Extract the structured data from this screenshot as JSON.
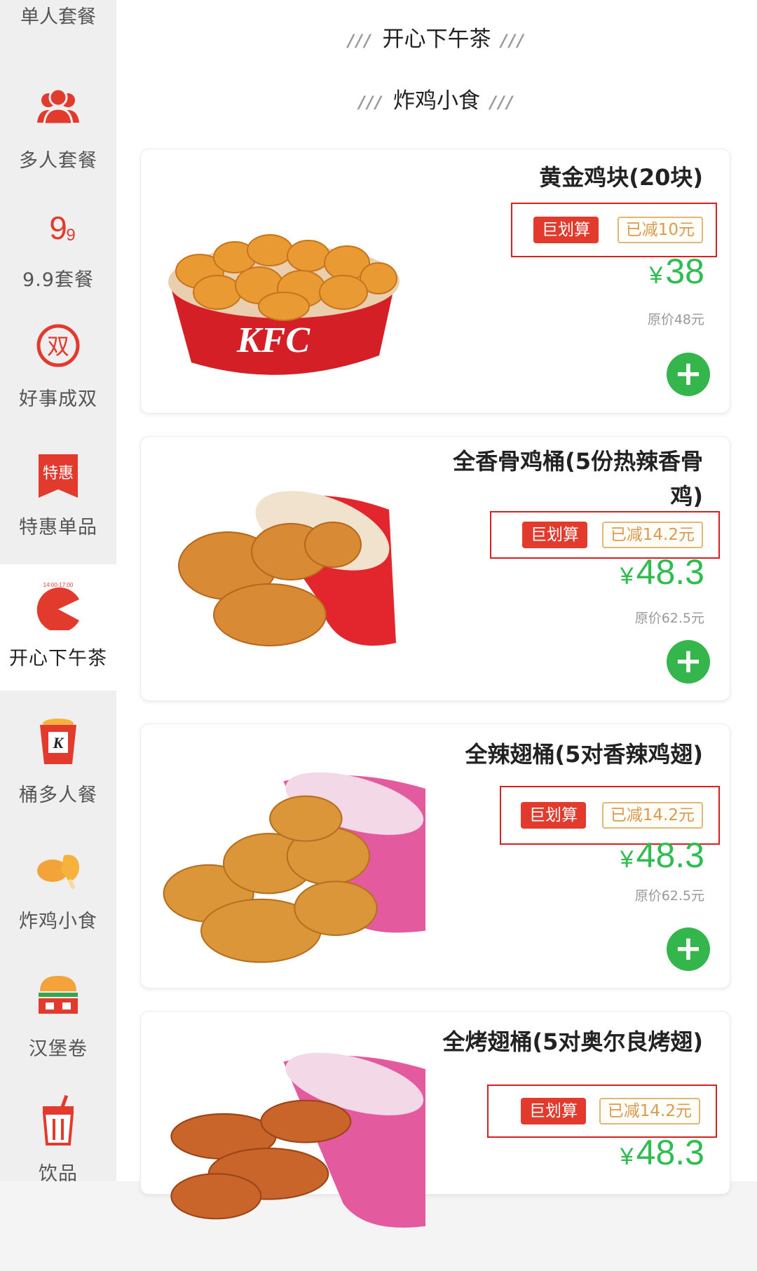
{
  "sidebar": {
    "top_cut_label": "单人套餐",
    "items": [
      {
        "label": "多人套餐",
        "icon": "group-icon"
      },
      {
        "label": "9.9套餐",
        "icon": "nine-nine-icon",
        "icon_text": "9.9"
      },
      {
        "label": "好事成双",
        "icon": "double-happiness-icon",
        "icon_text": "双"
      },
      {
        "label": "特惠单品",
        "icon": "special-offer-icon",
        "icon_text": "特惠"
      },
      {
        "label": "开心下午茶",
        "icon": "afternoon-tea-clock-icon",
        "icon_text": "14:00-17:00",
        "active": true
      },
      {
        "label": "桶多人餐",
        "icon": "bucket-icon",
        "icon_text": "K"
      },
      {
        "label": "炸鸡小食",
        "icon": "fried-chicken-icon"
      },
      {
        "label": "汉堡卷",
        "icon": "burger-icon"
      },
      {
        "label": "饮品",
        "icon": "drink-cup-icon"
      }
    ]
  },
  "main": {
    "section_title": "开心下午茶",
    "category_title": "炸鸡小食",
    "slashes": "///",
    "products": [
      {
        "name": "黄金鸡块(20块)",
        "badge": "巨划算",
        "discount": "已减10元",
        "currency": "¥",
        "price": "38",
        "original": "原价48元",
        "add_label": "+",
        "image": "nuggets-bucket",
        "bucket_text": "KFC"
      },
      {
        "name": "全香骨鸡桶(5份热辣香骨鸡)",
        "badge": "巨划算",
        "discount": "已减14.2元",
        "currency": "¥",
        "price": "48.3",
        "original": "原价62.5元",
        "add_label": "+",
        "image": "crispy-chicken-bucket"
      },
      {
        "name": "全辣翅桶(5对香辣鸡翅)",
        "badge": "巨划算",
        "discount": "已减14.2元",
        "currency": "¥",
        "price": "48.3",
        "original": "原价62.5元",
        "add_label": "+",
        "image": "spicy-wings-bucket"
      },
      {
        "name": "全烤翅桶(5对奥尔良烤翅)",
        "badge": "巨划算",
        "discount": "已减14.2元",
        "currency": "¥",
        "price": "48.3",
        "image": "roasted-wings-bucket"
      }
    ]
  },
  "colors": {
    "accent_red": "#e33a2e",
    "price_green": "#2fbd52",
    "discount_gold": "#d89b50",
    "highlight_box": "#d9201f"
  }
}
